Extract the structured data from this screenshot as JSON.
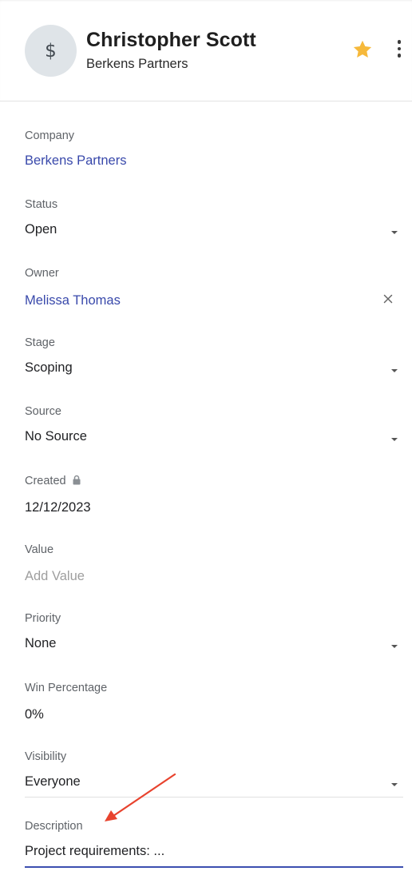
{
  "header": {
    "avatar_symbol": "$",
    "title": "Christopher Scott",
    "subtitle": "Berkens Partners",
    "star_color": "#f6b93b"
  },
  "fields": {
    "company": {
      "label": "Company",
      "value": "Berkens Partners"
    },
    "status": {
      "label": "Status",
      "value": "Open"
    },
    "owner": {
      "label": "Owner",
      "value": "Melissa Thomas"
    },
    "stage": {
      "label": "Stage",
      "value": "Scoping"
    },
    "source": {
      "label": "Source",
      "value": "No Source"
    },
    "created": {
      "label": "Created",
      "value": "12/12/2023"
    },
    "value": {
      "label": "Value",
      "placeholder": "Add Value"
    },
    "priority": {
      "label": "Priority",
      "value": "None"
    },
    "win_percentage": {
      "label": "Win Percentage",
      "value": "0%"
    },
    "visibility": {
      "label": "Visibility",
      "value": "Everyone"
    },
    "description": {
      "label": "Description",
      "value": "Project requirements: ..."
    }
  },
  "colors": {
    "link": "#3949ab",
    "focus": "#3c4fb0",
    "annotation_arrow": "#e8432e"
  }
}
